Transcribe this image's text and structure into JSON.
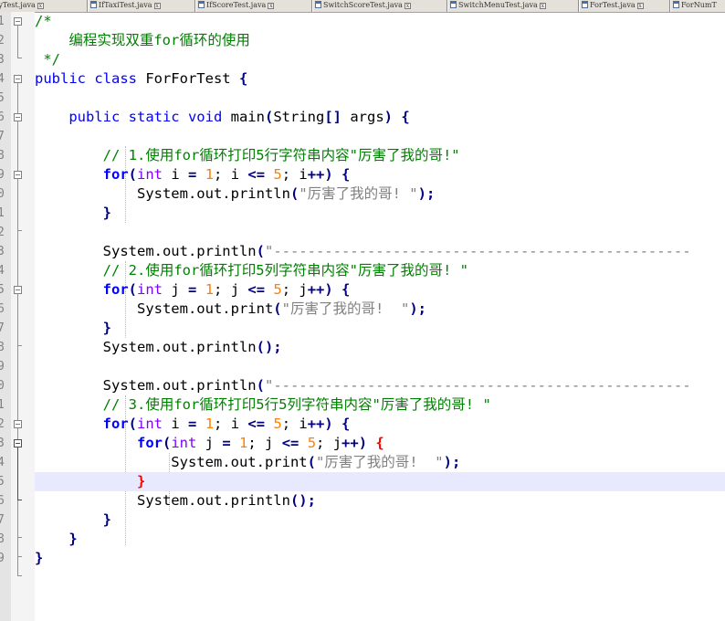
{
  "tabs": [
    {
      "label": "SalaryTest.java"
    },
    {
      "label": "IfTaxiTest.java"
    },
    {
      "label": "IfScoreTest.java"
    },
    {
      "label": "SwitchScoreTest.java"
    },
    {
      "label": "SwitchMenuTest.java"
    },
    {
      "label": "ForTest.java"
    },
    {
      "label": "ForNumT"
    }
  ],
  "line_numbers": [
    "1",
    "2",
    "3",
    "4",
    "5",
    "6",
    "7",
    "8",
    "9",
    "0",
    "1",
    "2",
    "3",
    "4",
    "5",
    "6",
    "7",
    "8",
    "9",
    "0",
    "1",
    "2",
    "3",
    "4",
    "5",
    "6",
    "7",
    "8",
    "9"
  ],
  "code": {
    "l1": "/*",
    "l2": "    编程实现双重for循环的使用",
    "l3": " */",
    "l4_kw": "public class",
    "l4_rest": " ForForTest ",
    "l4_brace": "{",
    "l6_indent": "    ",
    "l6_kw": "public static void",
    "l6_mid": " main",
    "l6_p1": "(",
    "l6_string": "String",
    "l6_arr": "[]",
    "l6_args": " args",
    "l6_p2": ")",
    "l6_brace": " {",
    "l8": "        // 1.使用for循环打印5行字符串内容\"厉害了我的哥!\"",
    "l9_indent": "        ",
    "l9_for": "for",
    "l9_p": "(",
    "l9_int": "int",
    "l9_a": " i ",
    "l9_eq": "=",
    "l9_sp": " ",
    "l9_n1": "1",
    "l9_s1": "; i ",
    "l9_le": "<=",
    "l9_sp2": " ",
    "l9_n5": "5",
    "l9_s2": "; i",
    "l9_pp": "++)",
    "l9_b": " {",
    "l10_indent": "            System.out.println",
    "l10_p": "(",
    "l10_str": "\"厉害了我的哥! \"",
    "l10_end": ");",
    "l11": "        }",
    "l13_a": "        System.out.println",
    "l13_p": "(",
    "l13_str": "\"-------------------------------------------------",
    "l14": "        // 2.使用for循环打印5列字符串内容\"厉害了我的哥! \"",
    "l15_j": " j ",
    "l15_s1": "; j ",
    "l15_s2": "; j",
    "l16_a": "            System.out.print",
    "l16_str": "\"厉害了我的哥!  \"",
    "l17": "        }",
    "l18": "        System.out.println",
    "l18_end": "();",
    "l21": "        // 3.使用for循环打印5行5列字符串内容\"厉害了我的哥! \"",
    "l23_indent": "            ",
    "l24_a": "                System.out.print",
    "l24_str": "\"厉害了我的哥!  \"",
    "l25_indent": "            ",
    "l25_brace": "}",
    "l26": "            System.out.println",
    "l27": "        }",
    "l28": "    }",
    "l29": "}"
  }
}
